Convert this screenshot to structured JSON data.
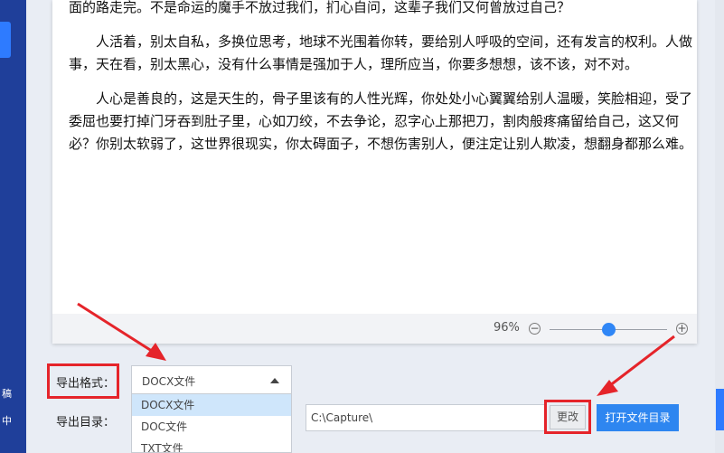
{
  "document": {
    "paragraphs": [
      "面的路走完。不是命运的魔手不放过我们，扪心自问，这辈子我们又何曾放过自己？",
      "人活着，别太自私，多换位思考，地球不光围着你转，要给别人呼吸的空间，还有发言的权利。人做事，天在看，别太黑心，没有什么事情是强加于人，理所应当，你要多想想，该不该，对不对。",
      "人心是善良的，这是天生的，骨子里该有的人性光辉，你处处小心翼翼给别人温暖，笑脸相迎，受了委屈也要打掉门牙吞到肚子里，心如刀绞，不去争论，忍字心上那把刀，割肉般疼痛留给自己，这又何必？你别太软弱了，这世界很现实，你太碍面子，不想伤害别人，便注定让别人欺凌，想翻身都那么难。"
    ]
  },
  "zoom": {
    "percent_label": "96%",
    "minus": "−",
    "plus": "+",
    "level": 0.5
  },
  "export": {
    "format_label": "导出格式：",
    "selected_format": "DOCX文件",
    "format_options": [
      "DOCX文件",
      "DOC文件",
      "TXT文件"
    ],
    "dir_label": "导出目录：",
    "dir_value": "C:\\Capture\\",
    "change_button": "更改",
    "open_folder_button": "打开文件目录"
  },
  "sidebar": {
    "glyph_1": "稿",
    "glyph_2": "中"
  },
  "colors": {
    "sidebar": "#1f3f9a",
    "accent": "#2e86f0",
    "highlight": "#e5242a",
    "selected_option": "#cfe6fb"
  }
}
